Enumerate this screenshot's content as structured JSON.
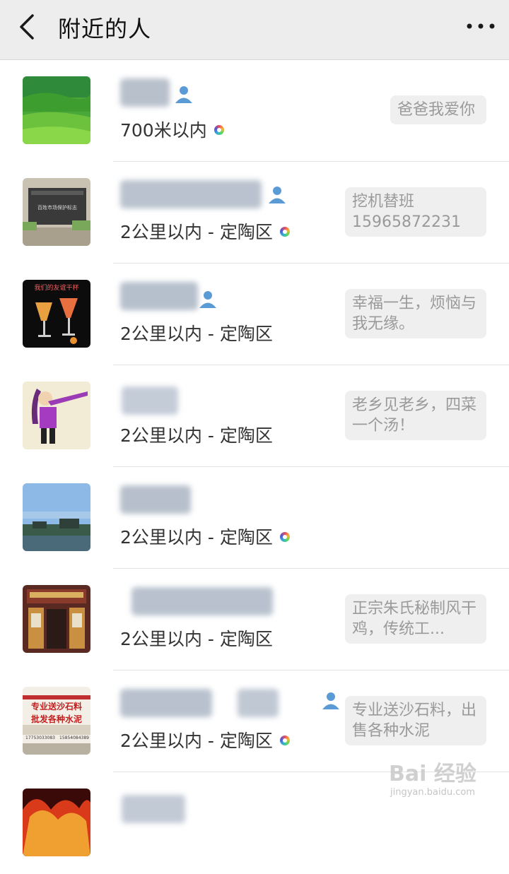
{
  "header": {
    "title": "附近的人"
  },
  "contacts": [
    {
      "distance": "700米以内",
      "signature": "爸爸我爱你"
    },
    {
      "distance": "2公里以内 - 定陶区",
      "signature": "挖机替班 15965872231"
    },
    {
      "distance": "2公里以内 - 定陶区",
      "signature": "幸福一生，烦恼与我无缘。"
    },
    {
      "distance": "2公里以内 - 定陶区",
      "signature": "老乡见老乡，四菜一个汤！"
    },
    {
      "distance": "2公里以内 - 定陶区",
      "signature": ""
    },
    {
      "distance": "2公里以内 - 定陶区",
      "signature": "正宗朱氏秘制风干鸡，传统工..."
    },
    {
      "distance": "2公里以内 - 定陶区",
      "signature": "专业送沙石料，出售各种水泥"
    }
  ],
  "avatars": {
    "a2_text": "百姓市场保护标志",
    "a3_text": "我们的友谊干杯",
    "a7_line1": "专业送沙石料",
    "a7_line2": "批发各种水泥",
    "a7_phone1": "17753033083",
    "a7_phone2": "15854084389"
  },
  "watermark": {
    "brand": "Bai 经验",
    "url": "jingyan.baidu.com"
  },
  "colors": {
    "header_bg": "#ededed",
    "accent_person": "#5b9bd5",
    "signature_bg": "#efefef"
  }
}
